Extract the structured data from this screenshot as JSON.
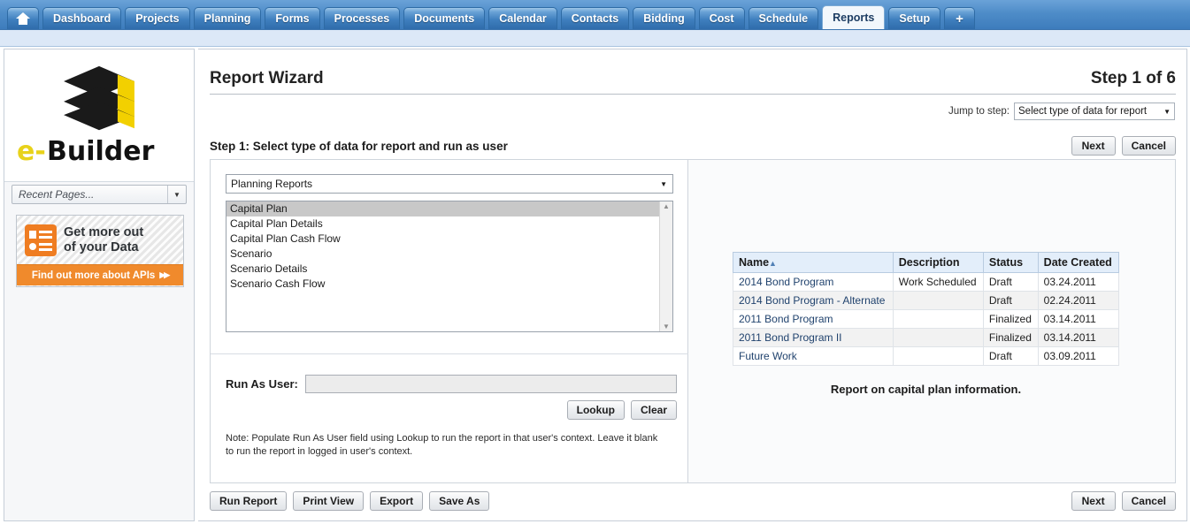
{
  "tabs": [
    {
      "label": "",
      "icon": "home-icon",
      "name": "tab-home",
      "active": false
    },
    {
      "label": "Dashboard",
      "name": "tab-dashboard",
      "active": false
    },
    {
      "label": "Projects",
      "name": "tab-projects",
      "active": false
    },
    {
      "label": "Planning",
      "name": "tab-planning",
      "active": false
    },
    {
      "label": "Forms",
      "name": "tab-forms",
      "active": false
    },
    {
      "label": "Processes",
      "name": "tab-processes",
      "active": false
    },
    {
      "label": "Documents",
      "name": "tab-documents",
      "active": false
    },
    {
      "label": "Calendar",
      "name": "tab-calendar",
      "active": false
    },
    {
      "label": "Contacts",
      "name": "tab-contacts",
      "active": false
    },
    {
      "label": "Bidding",
      "name": "tab-bidding",
      "active": false
    },
    {
      "label": "Cost",
      "name": "tab-cost",
      "active": false
    },
    {
      "label": "Schedule",
      "name": "tab-schedule",
      "active": false
    },
    {
      "label": "Reports",
      "name": "tab-reports",
      "active": true
    },
    {
      "label": "Setup",
      "name": "tab-setup",
      "active": false
    },
    {
      "label": "+",
      "name": "tab-add",
      "active": false
    }
  ],
  "sidebar": {
    "collapse_icon": "«",
    "logo": {
      "wordmark_e": "e-",
      "wordmark_builder": "Builder",
      "colors": {
        "yellow": "#F2D000",
        "black": "#1A1A1A"
      }
    },
    "recent_pages": {
      "placeholder": "Recent Pages...",
      "arrow": "▼"
    },
    "promo": {
      "line1": "Get more out",
      "line2": "of your Data",
      "cta": "Find out more about APIs",
      "cta_chevron": "▶▶",
      "accent_color": "#EF7D22"
    }
  },
  "page": {
    "title": "Report Wizard",
    "step_count": "Step 1 of 6",
    "jump_label": "Jump to step:",
    "jump_value": "Select type of data for report",
    "jump_arrow": "▼",
    "step_heading": "Step 1: Select type of data for report and run as user"
  },
  "top_actions": {
    "next": "Next",
    "cancel": "Cancel"
  },
  "left_panel": {
    "type_select": {
      "value": "Planning Reports",
      "arrow": "▼"
    },
    "report_list": {
      "items": [
        "Capital Plan",
        "Capital Plan Details",
        "Capital Plan Cash Flow",
        "Scenario",
        "Scenario Details",
        "Scenario Cash Flow"
      ],
      "selected_index": 0,
      "scroll_up": "▲",
      "scroll_down": "▼"
    },
    "run_as_user": {
      "label": "Run As User:",
      "value": "",
      "lookup": "Lookup",
      "clear": "Clear"
    },
    "note": "Note: Populate Run As User field using Lookup to run the report in that user's context. Leave it blank to run the report in logged in user's context."
  },
  "right_panel": {
    "caption": "Report on capital plan information.",
    "table": {
      "columns": [
        "Name",
        "Description",
        "Status",
        "Date Created"
      ],
      "sort_column": "Name",
      "sort_arrow": "▲",
      "rows": [
        {
          "name": "2014 Bond Program",
          "description": "Work Scheduled",
          "status": "Draft",
          "date_created": "03.24.2011"
        },
        {
          "name": "2014 Bond Program - Alternate",
          "description": "",
          "status": "Draft",
          "date_created": "02.24.2011"
        },
        {
          "name": "2011 Bond Program",
          "description": "",
          "status": "Finalized",
          "date_created": "03.14.2011"
        },
        {
          "name": "2011 Bond Program II",
          "description": "",
          "status": "Finalized",
          "date_created": "03.14.2011"
        },
        {
          "name": "Future Work",
          "description": "",
          "status": "Draft",
          "date_created": "03.09.2011"
        }
      ]
    }
  },
  "footer": {
    "run_report": "Run Report",
    "print_view": "Print View",
    "export": "Export",
    "save_as": "Save As",
    "next": "Next",
    "cancel": "Cancel"
  }
}
